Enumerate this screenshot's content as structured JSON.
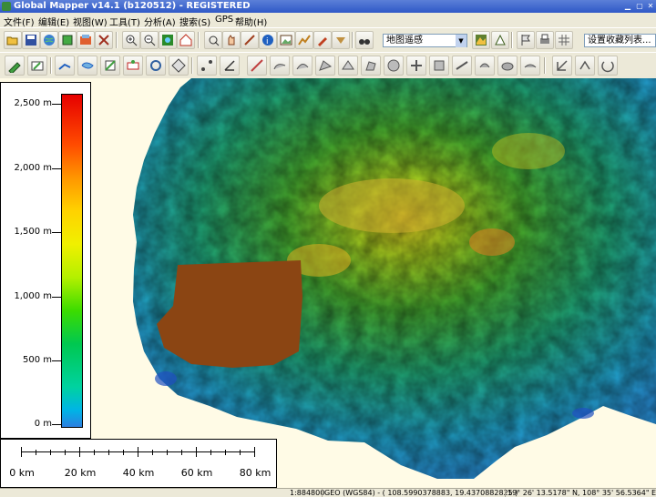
{
  "window": {
    "title": "Global Mapper v14.1 (b120512) - REGISTERED"
  },
  "menu": [
    "文件(F)",
    "编辑(E)",
    "视图(W)",
    "工具(T)",
    "分析(A)",
    "搜索(S)",
    "GPS",
    "帮助(H)"
  ],
  "toolbar": {
    "projection_select": "地图遥感",
    "favorites_select": "设置收藏列表..."
  },
  "legend": {
    "labels": [
      "2,500 m",
      "2,000 m",
      "1,500 m",
      "1,000 m",
      "500 m",
      "0 m"
    ]
  },
  "scale_bar": {
    "labels": [
      "0 km",
      "20 km",
      "40 km",
      "60 km",
      "80 km"
    ]
  },
  "status": {
    "scale": "1:884800",
    "coords": "GEO (WGS84) - ( 108.5990378883, 19.4370882825 )",
    "dms": "19° 26' 13.5178\" N, 108° 35' 56.5364\" E"
  },
  "colors": {
    "elevation_ramp": [
      "#2c7fe0",
      "#00d2a0",
      "#00c850",
      "#b4f000",
      "#f0f000",
      "#ff9600",
      "#e60000"
    ],
    "land_patch": "#8b4513",
    "background": "#fffbe6"
  }
}
